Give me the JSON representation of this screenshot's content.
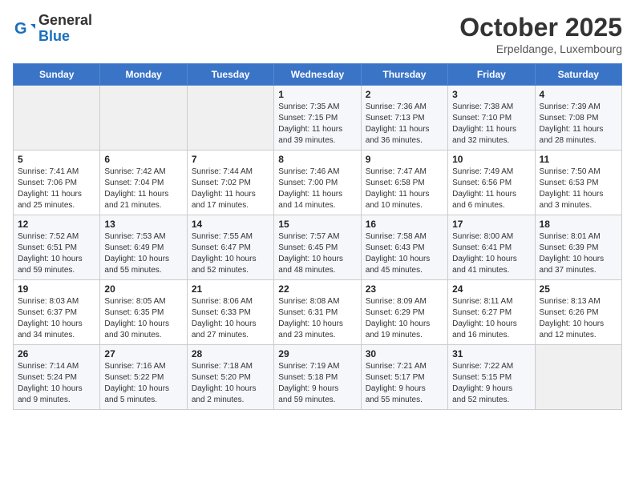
{
  "header": {
    "logo_general": "General",
    "logo_blue": "Blue",
    "month": "October 2025",
    "location": "Erpeldange, Luxembourg"
  },
  "weekdays": [
    "Sunday",
    "Monday",
    "Tuesday",
    "Wednesday",
    "Thursday",
    "Friday",
    "Saturday"
  ],
  "weeks": [
    [
      {
        "day": "",
        "info": ""
      },
      {
        "day": "",
        "info": ""
      },
      {
        "day": "",
        "info": ""
      },
      {
        "day": "1",
        "info": "Sunrise: 7:35 AM\nSunset: 7:15 PM\nDaylight: 11 hours\nand 39 minutes."
      },
      {
        "day": "2",
        "info": "Sunrise: 7:36 AM\nSunset: 7:13 PM\nDaylight: 11 hours\nand 36 minutes."
      },
      {
        "day": "3",
        "info": "Sunrise: 7:38 AM\nSunset: 7:10 PM\nDaylight: 11 hours\nand 32 minutes."
      },
      {
        "day": "4",
        "info": "Sunrise: 7:39 AM\nSunset: 7:08 PM\nDaylight: 11 hours\nand 28 minutes."
      }
    ],
    [
      {
        "day": "5",
        "info": "Sunrise: 7:41 AM\nSunset: 7:06 PM\nDaylight: 11 hours\nand 25 minutes."
      },
      {
        "day": "6",
        "info": "Sunrise: 7:42 AM\nSunset: 7:04 PM\nDaylight: 11 hours\nand 21 minutes."
      },
      {
        "day": "7",
        "info": "Sunrise: 7:44 AM\nSunset: 7:02 PM\nDaylight: 11 hours\nand 17 minutes."
      },
      {
        "day": "8",
        "info": "Sunrise: 7:46 AM\nSunset: 7:00 PM\nDaylight: 11 hours\nand 14 minutes."
      },
      {
        "day": "9",
        "info": "Sunrise: 7:47 AM\nSunset: 6:58 PM\nDaylight: 11 hours\nand 10 minutes."
      },
      {
        "day": "10",
        "info": "Sunrise: 7:49 AM\nSunset: 6:56 PM\nDaylight: 11 hours\nand 6 minutes."
      },
      {
        "day": "11",
        "info": "Sunrise: 7:50 AM\nSunset: 6:53 PM\nDaylight: 11 hours\nand 3 minutes."
      }
    ],
    [
      {
        "day": "12",
        "info": "Sunrise: 7:52 AM\nSunset: 6:51 PM\nDaylight: 10 hours\nand 59 minutes."
      },
      {
        "day": "13",
        "info": "Sunrise: 7:53 AM\nSunset: 6:49 PM\nDaylight: 10 hours\nand 55 minutes."
      },
      {
        "day": "14",
        "info": "Sunrise: 7:55 AM\nSunset: 6:47 PM\nDaylight: 10 hours\nand 52 minutes."
      },
      {
        "day": "15",
        "info": "Sunrise: 7:57 AM\nSunset: 6:45 PM\nDaylight: 10 hours\nand 48 minutes."
      },
      {
        "day": "16",
        "info": "Sunrise: 7:58 AM\nSunset: 6:43 PM\nDaylight: 10 hours\nand 45 minutes."
      },
      {
        "day": "17",
        "info": "Sunrise: 8:00 AM\nSunset: 6:41 PM\nDaylight: 10 hours\nand 41 minutes."
      },
      {
        "day": "18",
        "info": "Sunrise: 8:01 AM\nSunset: 6:39 PM\nDaylight: 10 hours\nand 37 minutes."
      }
    ],
    [
      {
        "day": "19",
        "info": "Sunrise: 8:03 AM\nSunset: 6:37 PM\nDaylight: 10 hours\nand 34 minutes."
      },
      {
        "day": "20",
        "info": "Sunrise: 8:05 AM\nSunset: 6:35 PM\nDaylight: 10 hours\nand 30 minutes."
      },
      {
        "day": "21",
        "info": "Sunrise: 8:06 AM\nSunset: 6:33 PM\nDaylight: 10 hours\nand 27 minutes."
      },
      {
        "day": "22",
        "info": "Sunrise: 8:08 AM\nSunset: 6:31 PM\nDaylight: 10 hours\nand 23 minutes."
      },
      {
        "day": "23",
        "info": "Sunrise: 8:09 AM\nSunset: 6:29 PM\nDaylight: 10 hours\nand 19 minutes."
      },
      {
        "day": "24",
        "info": "Sunrise: 8:11 AM\nSunset: 6:27 PM\nDaylight: 10 hours\nand 16 minutes."
      },
      {
        "day": "25",
        "info": "Sunrise: 8:13 AM\nSunset: 6:26 PM\nDaylight: 10 hours\nand 12 minutes."
      }
    ],
    [
      {
        "day": "26",
        "info": "Sunrise: 7:14 AM\nSunset: 5:24 PM\nDaylight: 10 hours\nand 9 minutes."
      },
      {
        "day": "27",
        "info": "Sunrise: 7:16 AM\nSunset: 5:22 PM\nDaylight: 10 hours\nand 5 minutes."
      },
      {
        "day": "28",
        "info": "Sunrise: 7:18 AM\nSunset: 5:20 PM\nDaylight: 10 hours\nand 2 minutes."
      },
      {
        "day": "29",
        "info": "Sunrise: 7:19 AM\nSunset: 5:18 PM\nDaylight: 9 hours\nand 59 minutes."
      },
      {
        "day": "30",
        "info": "Sunrise: 7:21 AM\nSunset: 5:17 PM\nDaylight: 9 hours\nand 55 minutes."
      },
      {
        "day": "31",
        "info": "Sunrise: 7:22 AM\nSunset: 5:15 PM\nDaylight: 9 hours\nand 52 minutes."
      },
      {
        "day": "",
        "info": ""
      }
    ]
  ]
}
